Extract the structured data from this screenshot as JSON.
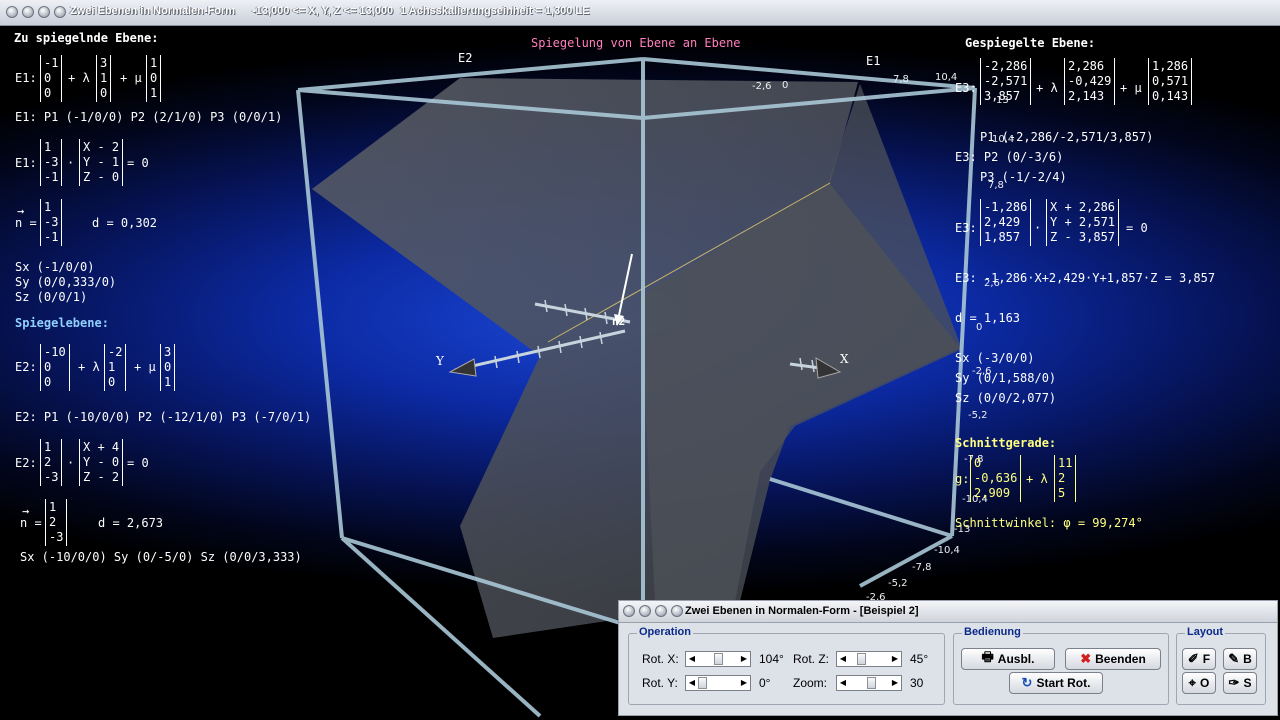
{
  "window": {
    "title": "Zwei Ebenen in Normalen-Form",
    "range": "-13,000 <= X, Y, Z <= 13,000",
    "scale": "1 Achsskalierungseinheit = 1,300 LE"
  },
  "scene": {
    "title": "Spiegelung von Ebene an Ebene",
    "label_e2": "E2",
    "label_e1": "E1",
    "axis_y": "Y",
    "axis_x": "X",
    "normal_label": "n2",
    "ticks": [
      "7,8",
      "10,4",
      "-2,6",
      "0",
      "13",
      "10,4",
      "7,8",
      "2,6",
      "0",
      "-2,6",
      "-5,2",
      "-7,8",
      "-10,4",
      "-13",
      "-10,4",
      "-7,8",
      "-5,2",
      "-2,6"
    ]
  },
  "left": {
    "heading1": "Zu spiegelnde Ebene:",
    "e1_param": {
      "lhs": "E1:",
      "v0": [
        "-1",
        "0",
        "0"
      ],
      "op1": "+ λ",
      "v1": [
        "3",
        "1",
        "0"
      ],
      "op2": "+ μ",
      "v2": [
        "1",
        "0",
        "1"
      ]
    },
    "e1_points": "E1: P1 (-1/0/0)   P2 (2/1/0)   P3 (0/0/1)",
    "e1_normal": {
      "lhs": "E1:",
      "n": [
        "1",
        "-3",
        "-1"
      ],
      "dot": "·",
      "x": [
        "X - 2",
        "Y - 1",
        "Z - 0"
      ],
      "rhs": "= 0"
    },
    "n1": {
      "arrow": "→",
      "lhs": "n =",
      "n": [
        "1",
        "-3",
        "-1"
      ],
      "d": "d = 0,302"
    },
    "e1_sx": "Sx (-1/0/0)",
    "e1_sy": "Sy (0/0,333/0)",
    "e1_sz": "Sz (0/0/1)",
    "heading2": "Spiegelebene:",
    "e2_param": {
      "lhs": "E2:",
      "v0": [
        "-10",
        "0",
        "0"
      ],
      "op1": "+ λ",
      "v1": [
        "-2",
        "1",
        "0"
      ],
      "op2": "+ μ",
      "v2": [
        "3",
        "0",
        "1"
      ]
    },
    "e2_points": "E2: P1 (-10/0/0)   P2 (-12/1/0)   P3 (-7/0/1)",
    "e2_normal": {
      "lhs": "E2:",
      "n": [
        "1",
        "2",
        "-3"
      ],
      "dot": "·",
      "x": [
        "X + 4",
        "Y - 0",
        "Z - 2"
      ],
      "rhs": "= 0"
    },
    "n2": {
      "arrow": "→",
      "lhs": "n =",
      "n": [
        "1",
        "2",
        "-3"
      ],
      "d": "d = 2,673"
    },
    "e2_s": "Sx (-10/0/0)   Sy (0/-5/0)   Sz (0/0/3,333)"
  },
  "right": {
    "heading": "Gespiegelte Ebene:",
    "e3_param": {
      "lhs": "E3:",
      "v0": [
        "-2,286",
        "-2,571",
        "3,857"
      ],
      "op1": "+ λ",
      "v1": [
        "2,286",
        "-0,429",
        "2,143"
      ],
      "op2": "+ μ",
      "v2": [
        "1,286",
        "0,571",
        "0,143"
      ]
    },
    "p1": "P1 (-2,286/-2,571/3,857)",
    "p2": "E3: P2 (0/-3/6)",
    "p3": "P3 (-1/-2/4)",
    "e3_normal": {
      "lhs": "E3:",
      "n": [
        "-1,286",
        "2,429",
        "1,857"
      ],
      "dot": "·",
      "x": [
        "X + 2,286",
        "Y + 2,571",
        "Z - 3,857"
      ],
      "rhs": "= 0"
    },
    "e3_coord": "E3: -1,286·X+2,429·Y+1,857·Z = 3,857",
    "d": "d = 1,163",
    "sx": "Sx (-3/0/0)",
    "sy": "Sy (0/1,588/0)",
    "sz": "Sz (0/0/2,077)",
    "sg_heading": "Schnittgerade:",
    "g": {
      "lhs": "g:",
      "v0": [
        "0",
        "-0,636",
        "2,909"
      ],
      "op": "+ λ",
      "v1": [
        "11",
        "2",
        "5"
      ]
    },
    "angle": "Schnittwinkel: φ = 99,274°"
  },
  "colors": {
    "heading_white": "#ffffff",
    "heading_cyan": "#8fd0ff",
    "heading_yellow": "#ffff80",
    "title_pink": "#ff7fbf",
    "group_title": "#0a2a8a"
  },
  "dialog": {
    "title": "Zwei Ebenen in Normalen-Form - [Beispiel 2]",
    "operation_title": "Operation",
    "rot_x_label": "Rot. X:",
    "rot_x_value": "104°",
    "rot_y_label": "Rot. Y:",
    "rot_y_value": "0°",
    "rot_z_label": "Rot. Z:",
    "rot_z_value": "45°",
    "zoom_label": "Zoom:",
    "zoom_value": "30",
    "bedienung_title": "Bedienung",
    "ausbl_label": "Ausbl.",
    "beenden_label": "Beenden",
    "start_rot_label": "Start Rot.",
    "layout_title": "Layout",
    "f_label": "F",
    "b_label": "B",
    "o_label": "O",
    "s_label": "S"
  }
}
